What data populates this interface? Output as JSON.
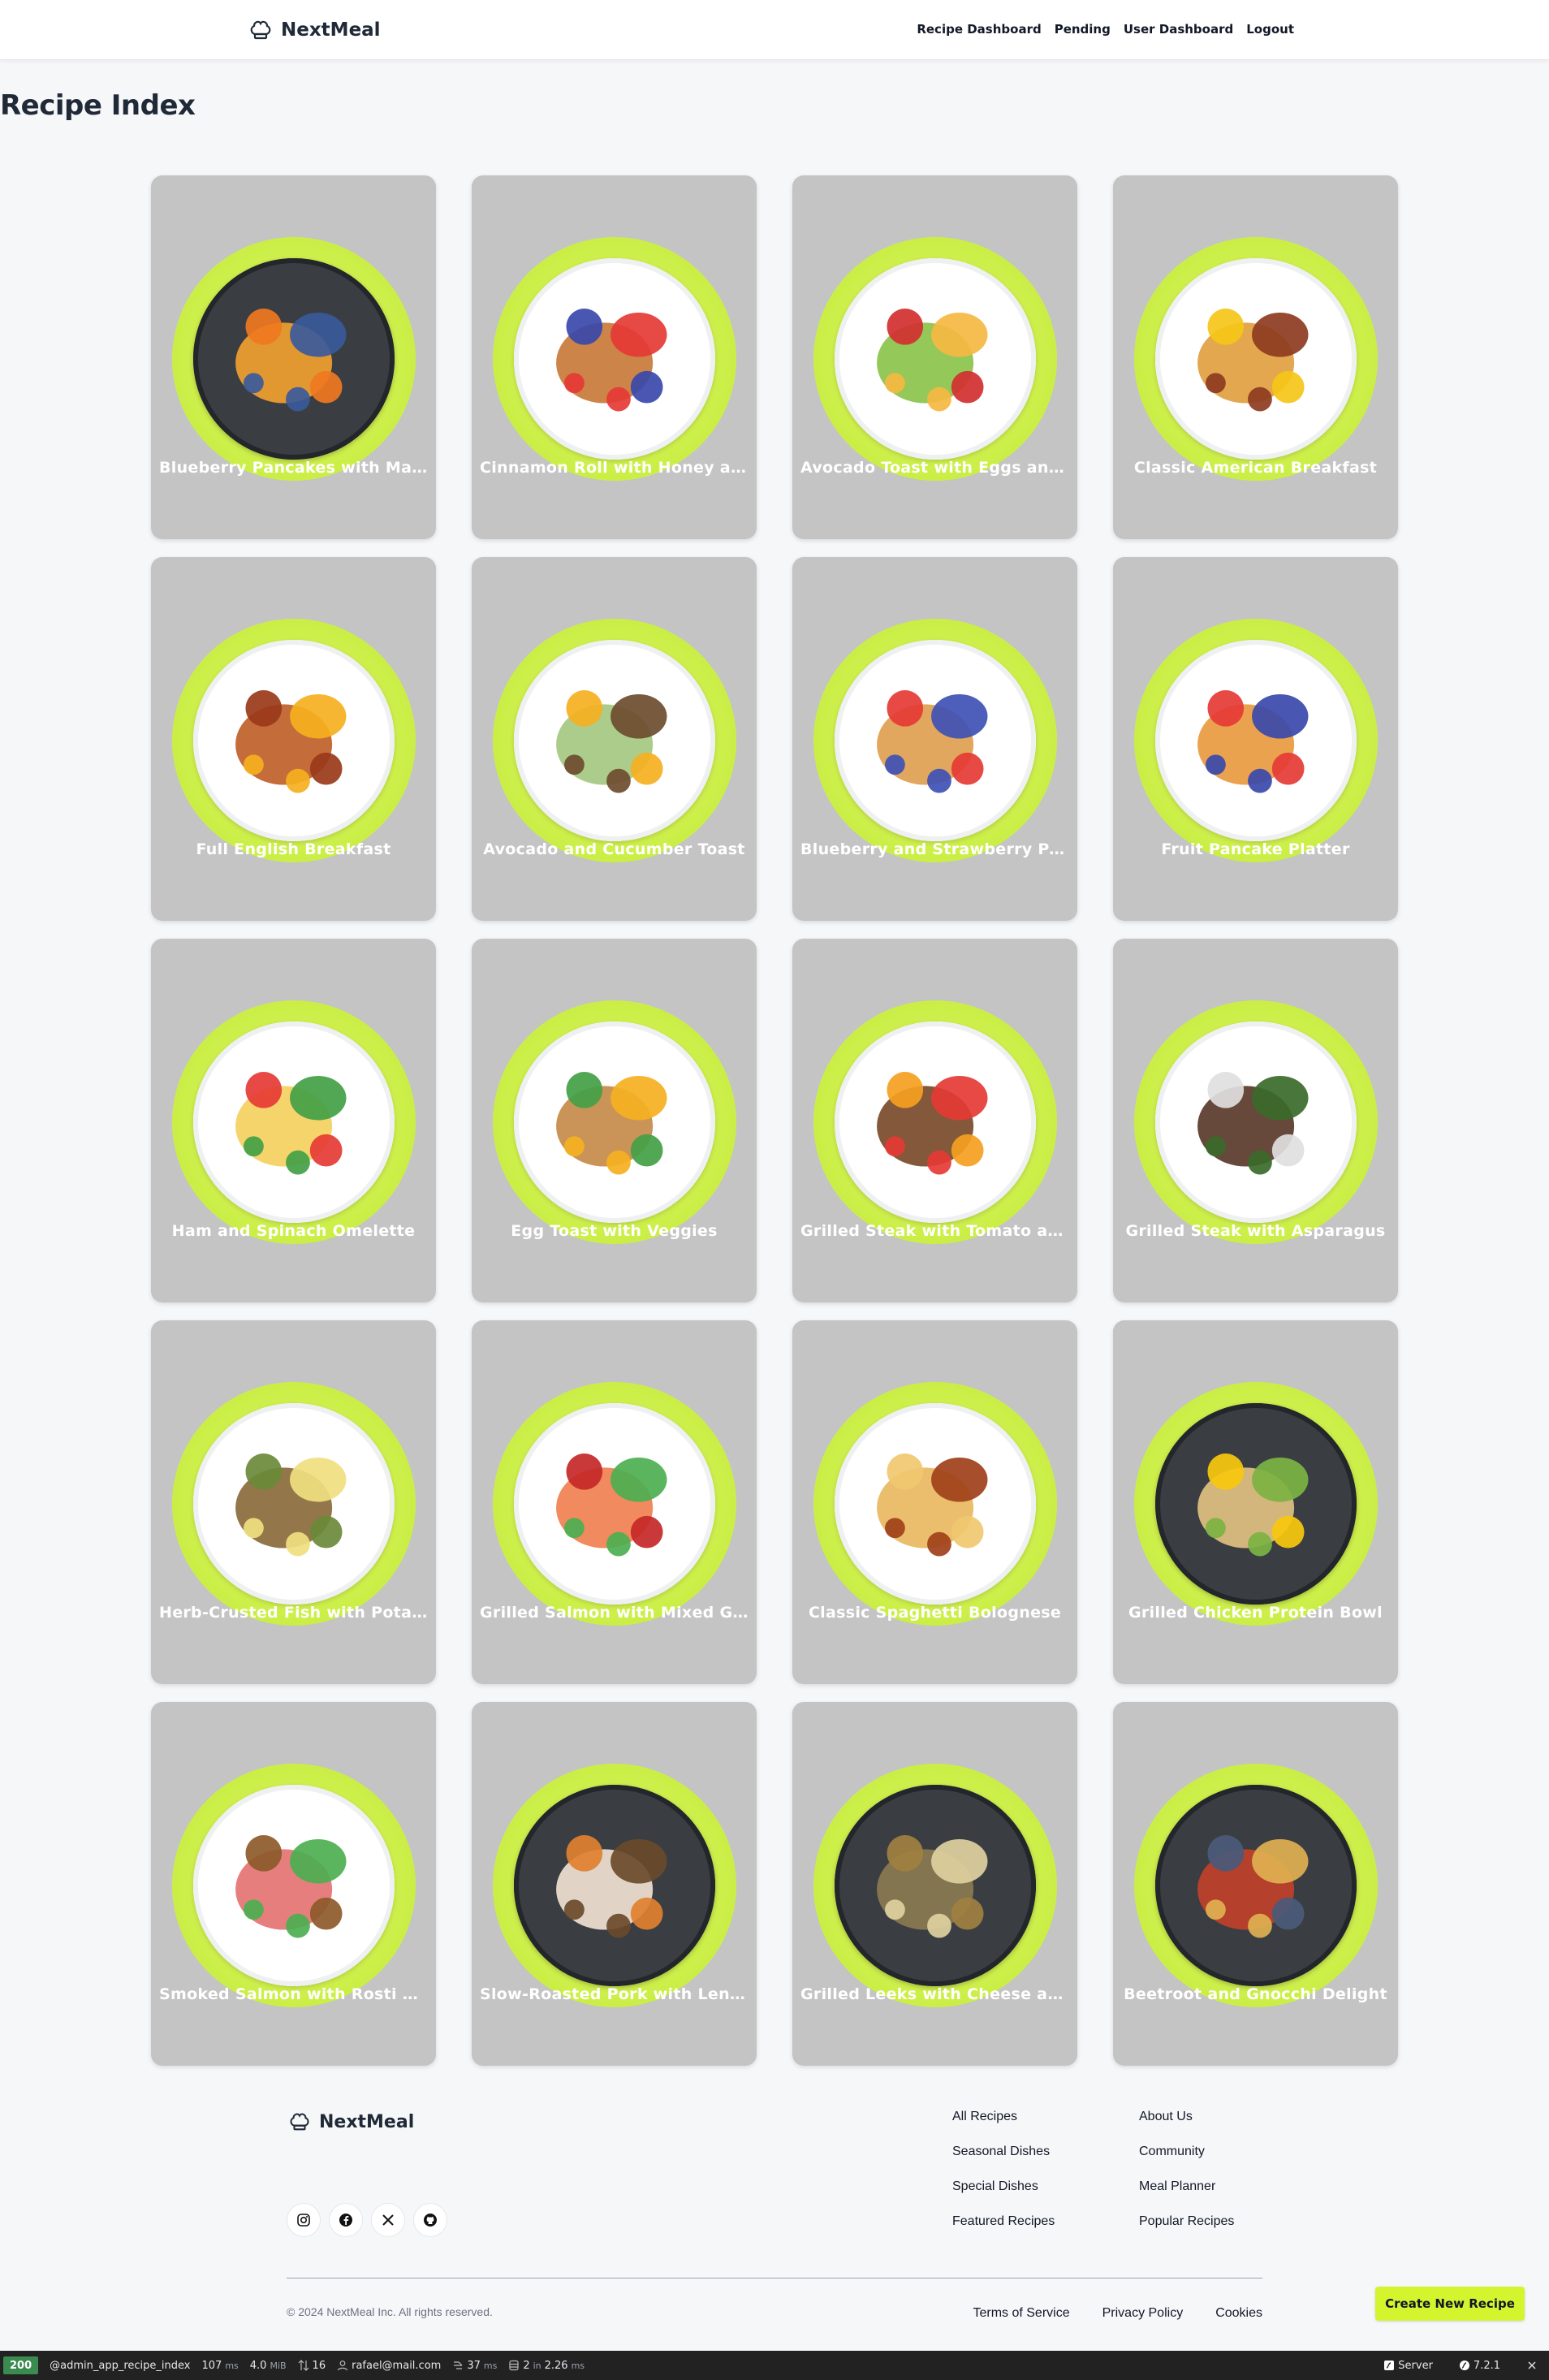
{
  "nav": {
    "brand": "NextMeal",
    "links": [
      "Recipe Dashboard",
      "Pending",
      "User Dashboard",
      "Logout"
    ]
  },
  "page": {
    "title": "Recipe Index"
  },
  "recipes": [
    {
      "title": "Blueberry Pancakes with Man…",
      "plate": "dark",
      "food": [
        "#f0a030",
        "#3a5a9a",
        "#f07820"
      ]
    },
    {
      "title": "Cinnamon Roll with Honey an…",
      "plate": "light",
      "food": [
        "#c97a3a",
        "#e53935",
        "#3949ab"
      ]
    },
    {
      "title": "Avocado Toast with Eggs and…",
      "plate": "light",
      "food": [
        "#8bc34a",
        "#f5b942",
        "#d32f2f"
      ]
    },
    {
      "title": "Classic American Breakfast",
      "plate": "light",
      "food": [
        "#e0a040",
        "#8d3b1f",
        "#f5c518"
      ]
    },
    {
      "title": "Full English Breakfast",
      "plate": "light",
      "food": [
        "#c0602a",
        "#f5b020",
        "#9a3a1a"
      ]
    },
    {
      "title": "Avocado and Cucumber Toast",
      "plate": "light",
      "food": [
        "#a5c882",
        "#6d4c2f",
        "#f5b020"
      ]
    },
    {
      "title": "Blueberry and Strawberry Pa…",
      "plate": "light",
      "food": [
        "#e0a050",
        "#3f51b5",
        "#e53935"
      ]
    },
    {
      "title": "Fruit Pancake Platter",
      "plate": "light",
      "food": [
        "#e89a40",
        "#3949ab",
        "#e53935"
      ]
    },
    {
      "title": "Ham and Spinach Omelette",
      "plate": "light",
      "food": [
        "#f5d060",
        "#43a047",
        "#e53935"
      ]
    },
    {
      "title": "Egg Toast with Veggies",
      "plate": "light",
      "food": [
        "#c68a4a",
        "#f5b020",
        "#43a047"
      ]
    },
    {
      "title": "Grilled Steak with Tomato an…",
      "plate": "light",
      "food": [
        "#7a4a2a",
        "#e53935",
        "#f5a020"
      ]
    },
    {
      "title": "Grilled Steak with Asparagus",
      "plate": "light",
      "food": [
        "#5a3a2a",
        "#3a6a2a",
        "#e0e0e0"
      ]
    },
    {
      "title": "Herb-Crusted Fish with Potat…",
      "plate": "light",
      "food": [
        "#8a6a3a",
        "#f0e080",
        "#6a8a3a"
      ]
    },
    {
      "title": "Grilled Salmon with Mixed Gr…",
      "plate": "light",
      "food": [
        "#f08050",
        "#4caf50",
        "#c62828"
      ]
    },
    {
      "title": "Classic Spaghetti Bolognese",
      "plate": "light",
      "food": [
        "#e8b860",
        "#a0401a",
        "#f0c870"
      ]
    },
    {
      "title": "Grilled Chicken Protein Bowl",
      "plate": "dark",
      "food": [
        "#e0c080",
        "#7cb342",
        "#f9c80e"
      ]
    },
    {
      "title": "Smoked Salmon with Rosti an…",
      "plate": "light",
      "food": [
        "#e57373",
        "#4caf50",
        "#8d5a2a"
      ]
    },
    {
      "title": "Slow-Roasted Pork with Lentils",
      "plate": "dark",
      "food": [
        "#f0e0d0",
        "#6a4a2a",
        "#e08030"
      ]
    },
    {
      "title": "Grilled Leeks with Cheese an…",
      "plate": "dark",
      "food": [
        "#8a7a50",
        "#e0d0a0",
        "#a08040"
      ]
    },
    {
      "title": "Beetroot and Gnocchi Delight",
      "plate": "dark",
      "food": [
        "#c0402a",
        "#e0b050",
        "#4a5a7a"
      ]
    }
  ],
  "footer": {
    "brand": "NextMeal",
    "col1": [
      "All Recipes",
      "Seasonal Dishes",
      "Special Dishes",
      "Featured Recipes"
    ],
    "col2": [
      "About Us",
      "Community",
      "Meal Planner",
      "Popular Recipes"
    ],
    "socials": [
      "instagram-icon",
      "facebook-icon",
      "x-icon",
      "github-icon"
    ],
    "copyright": "© 2024 NextMeal Inc. All rights reserved.",
    "legal": [
      "Terms of Service",
      "Privacy Policy",
      "Cookies"
    ]
  },
  "actions": {
    "create": "Create New Recipe"
  },
  "toolbar": {
    "status": "200",
    "route": "@admin_app_recipe_index",
    "time": "107",
    "time_unit": "ms",
    "memory": "4.0",
    "memory_unit": "MiB",
    "events": "16",
    "user": "rafael@mail.com",
    "listeners": "37",
    "listeners_unit": "ms",
    "db": "2",
    "db_in": "in",
    "db_time": "2.26",
    "db_unit": "ms",
    "server": "Server",
    "version": "7.2.1"
  },
  "colors": {
    "accent": "#d4f52e",
    "ring": "#c8ef3f",
    "card": "#c4c4c4"
  }
}
